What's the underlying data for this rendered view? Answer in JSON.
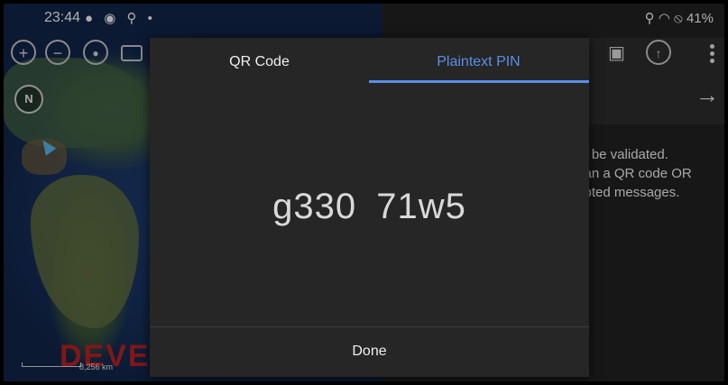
{
  "status_bar": {
    "time": "23:44",
    "left_icons": "● ◉ ⚲ •",
    "right_text": "⚲ ◠ ⦸ 41%"
  },
  "map": {
    "compass_label": "N",
    "scale_label": "8,256 km",
    "watermark": "DEVEL"
  },
  "panel": {
    "text_lines": [
      "st be validated.",
      "can a QR code OR",
      "ypted messages."
    ]
  },
  "dialog": {
    "tabs": [
      {
        "label": "QR Code",
        "active": false
      },
      {
        "label": "Plaintext PIN",
        "active": true
      }
    ],
    "pin": "g330  71w5",
    "done_label": "Done"
  },
  "colors": {
    "accent": "#5b8ee6",
    "dialog_bg": "#262626",
    "panel_bg": "#212121"
  }
}
